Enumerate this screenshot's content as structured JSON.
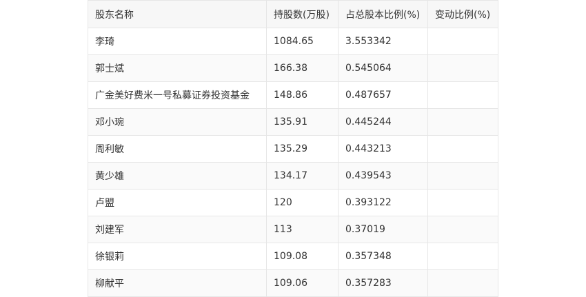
{
  "table": {
    "headers": [
      "股东名称",
      "持股数(万股)",
      "占总股本比例(%)",
      "变动比例(%)"
    ],
    "rows": [
      [
        "李琦",
        "1084.65",
        "3.553342",
        ""
      ],
      [
        "郭士斌",
        "166.38",
        "0.545064",
        ""
      ],
      [
        "广金美好费米一号私募证券投资基金",
        "148.86",
        "0.487657",
        ""
      ],
      [
        "邓小琬",
        "135.91",
        "0.445244",
        ""
      ],
      [
        "周利敏",
        "135.29",
        "0.443213",
        ""
      ],
      [
        "黄少雄",
        "134.17",
        "0.439543",
        ""
      ],
      [
        "卢盟",
        "120",
        "0.393122",
        ""
      ],
      [
        "刘建军",
        "113",
        "0.37019",
        ""
      ],
      [
        "徐银莉",
        "109.08",
        "0.357348",
        ""
      ],
      [
        "柳献平",
        "109.06",
        "0.357283",
        ""
      ]
    ]
  }
}
